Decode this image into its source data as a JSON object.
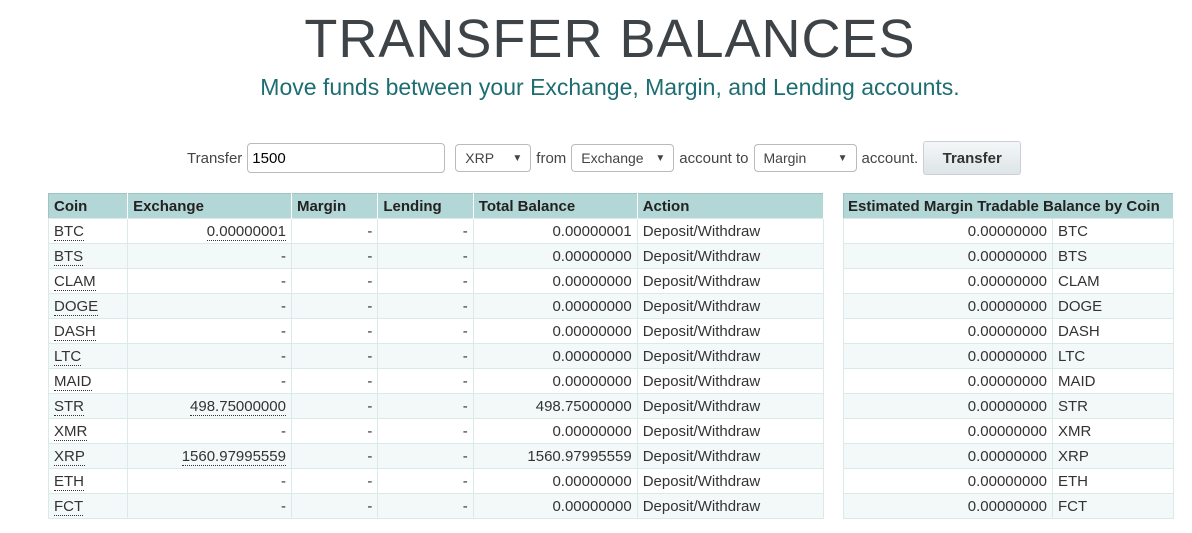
{
  "title": "TRANSFER BALANCES",
  "subtitle": "Move funds between your Exchange, Margin, and Lending accounts.",
  "form": {
    "transfer_label": "Transfer",
    "amount": "1500",
    "coin": "XRP",
    "from_label": "from",
    "from_account": "Exchange",
    "to_label": "account to",
    "to_account": "Margin",
    "end_label": "account.",
    "button": "Transfer"
  },
  "balances": {
    "headers": [
      "Coin",
      "Exchange",
      "Margin",
      "Lending",
      "Total Balance",
      "Action"
    ],
    "rows": [
      [
        "BTC",
        "0.00000001",
        "-",
        "-",
        "0.00000001",
        "Deposit/Withdraw"
      ],
      [
        "BTS",
        "-",
        "-",
        "-",
        "0.00000000",
        "Deposit/Withdraw"
      ],
      [
        "CLAM",
        "-",
        "-",
        "-",
        "0.00000000",
        "Deposit/Withdraw"
      ],
      [
        "DOGE",
        "-",
        "-",
        "-",
        "0.00000000",
        "Deposit/Withdraw"
      ],
      [
        "DASH",
        "-",
        "-",
        "-",
        "0.00000000",
        "Deposit/Withdraw"
      ],
      [
        "LTC",
        "-",
        "-",
        "-",
        "0.00000000",
        "Deposit/Withdraw"
      ],
      [
        "MAID",
        "-",
        "-",
        "-",
        "0.00000000",
        "Deposit/Withdraw"
      ],
      [
        "STR",
        "498.75000000",
        "-",
        "-",
        "498.75000000",
        "Deposit/Withdraw"
      ],
      [
        "XMR",
        "-",
        "-",
        "-",
        "0.00000000",
        "Deposit/Withdraw"
      ],
      [
        "XRP",
        "1560.97995559",
        "-",
        "-",
        "1560.97995559",
        "Deposit/Withdraw"
      ],
      [
        "ETH",
        "-",
        "-",
        "-",
        "0.00000000",
        "Deposit/Withdraw"
      ],
      [
        "FCT",
        "-",
        "-",
        "-",
        "0.00000000",
        "Deposit/Withdraw"
      ]
    ]
  },
  "margin": {
    "header": "Estimated Margin Tradable Balance by Coin",
    "rows": [
      [
        "0.00000000",
        "BTC"
      ],
      [
        "0.00000000",
        "BTS"
      ],
      [
        "0.00000000",
        "CLAM"
      ],
      [
        "0.00000000",
        "DOGE"
      ],
      [
        "0.00000000",
        "DASH"
      ],
      [
        "0.00000000",
        "LTC"
      ],
      [
        "0.00000000",
        "MAID"
      ],
      [
        "0.00000000",
        "STR"
      ],
      [
        "0.00000000",
        "XMR"
      ],
      [
        "0.00000000",
        "XRP"
      ],
      [
        "0.00000000",
        "ETH"
      ],
      [
        "0.00000000",
        "FCT"
      ]
    ]
  }
}
